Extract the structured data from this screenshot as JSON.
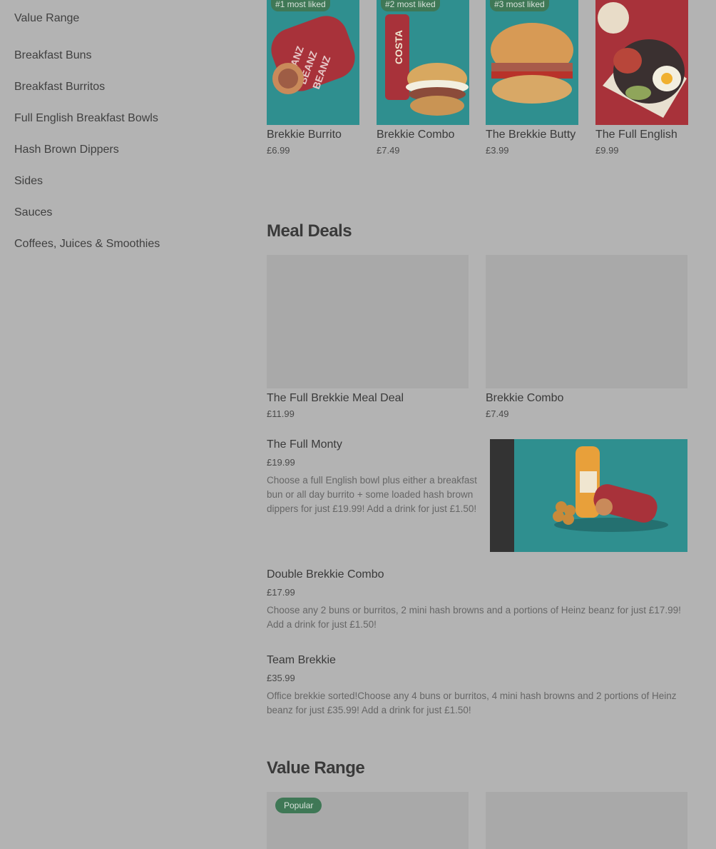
{
  "sidebar": {
    "items": [
      {
        "label": "Value Range"
      },
      {
        "label": "Breakfast Buns"
      },
      {
        "label": "Breakfast Burritos"
      },
      {
        "label": "Full English Breakfast Bowls"
      },
      {
        "label": "Hash Brown Dippers"
      },
      {
        "label": "Sides"
      },
      {
        "label": "Sauces"
      },
      {
        "label": "Coffees, Juices & Smoothies"
      }
    ]
  },
  "top_items": [
    {
      "badge": "#1 most liked",
      "name": "Brekkie Burrito",
      "price": "£6.99"
    },
    {
      "badge": "#2 most liked",
      "name": "Brekkie Combo",
      "price": "£7.49"
    },
    {
      "badge": "#3 most liked",
      "name": "The Brekkie Butty",
      "price": "£3.99"
    },
    {
      "badge": "",
      "name": "The Full English",
      "price": "£9.99"
    }
  ],
  "meal_deals": {
    "title": "Meal Deals",
    "cards": [
      {
        "name": "The Full Brekkie Meal Deal",
        "price": "£11.99"
      },
      {
        "name": "Brekkie Combo",
        "price": "£7.49"
      }
    ],
    "rows": [
      {
        "name": "The Full Monty",
        "price": "£19.99",
        "desc": "Choose a full English bowl plus either a breakfast bun or all day burrito + some loaded hash brown dippers for just £19.99! Add a drink for just £1.50!"
      },
      {
        "name": "Double Brekkie Combo",
        "price": "£17.99",
        "desc": "Choose any 2 buns or burritos, 2 mini hash browns and a portions of Heinz beanz for just £17.99! Add a drink for just £1.50!"
      },
      {
        "name": "Team Brekkie",
        "price": "£35.99",
        "desc": "Office brekkie sorted!Choose any 4 buns or burritos, 4 mini hash browns and 2 portions of Heinz beanz for just £35.99! Add a drink for just £1.50!"
      }
    ]
  },
  "value_range": {
    "title": "Value Range",
    "popular_badge": "Popular"
  },
  "colors": {
    "overlay_bg": "#b3b3b3",
    "badge_green": "#3f7856",
    "teal": "#2f8f8f",
    "red": "#a8323a"
  }
}
